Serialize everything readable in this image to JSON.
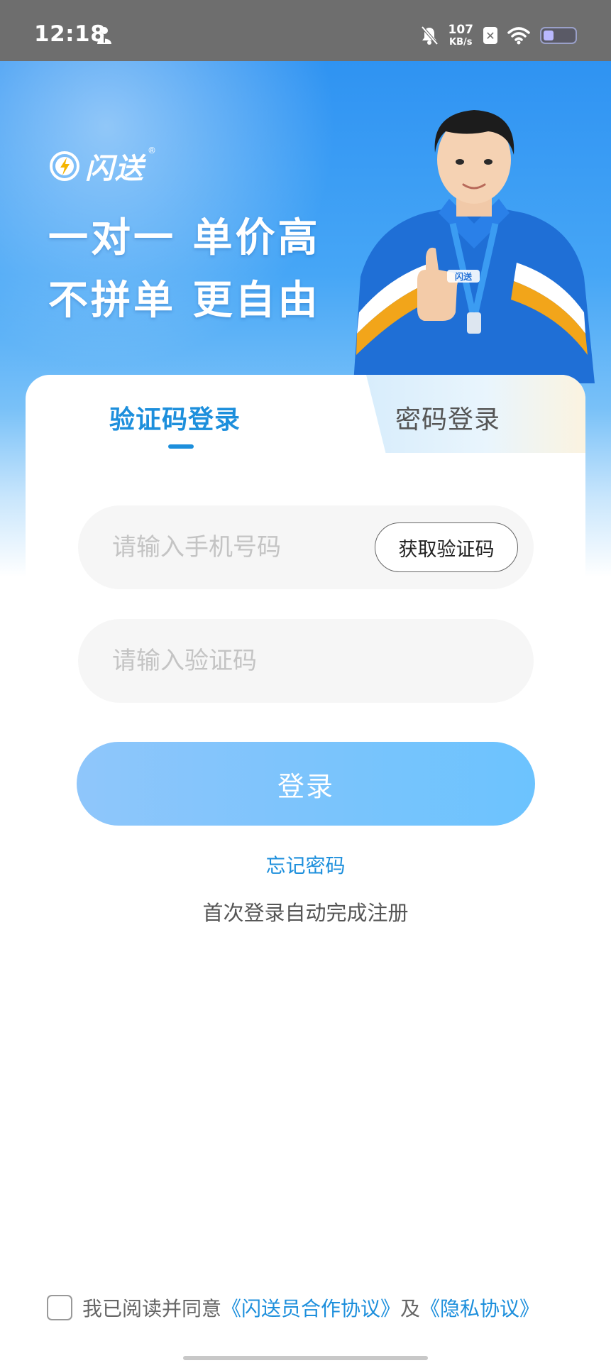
{
  "status_bar": {
    "time": "12:18",
    "net_speed_value": "107",
    "net_speed_unit": "KB/s",
    "icons": [
      "person-icon",
      "mute-bell-icon",
      "sim-x-icon",
      "wifi-icon",
      "battery-icon"
    ]
  },
  "brand": {
    "name": "闪送",
    "registered_mark": "®",
    "slogan_line1": "一对一 单价高",
    "slogan_line2": "不拼单 更自由",
    "badge_text": "闪送"
  },
  "login": {
    "tabs": [
      {
        "label": "验证码登录",
        "active": true
      },
      {
        "label": "密码登录",
        "active": false
      }
    ],
    "phone_placeholder": "请输入手机号码",
    "get_code_label": "获取验证码",
    "code_placeholder": "请输入验证码",
    "submit_label": "登录",
    "forgot_label": "忘记密码",
    "auto_register_note": "首次登录自动完成注册"
  },
  "agreement": {
    "checked": false,
    "prefix": "我已阅读并同意",
    "link1": "《闪送员合作协议》",
    "conjunction": "及",
    "link2": "《隐私协议》"
  },
  "colors": {
    "accent": "#1d8fdc",
    "hero_blue": "#2f93f2",
    "button_gradient_start": "#8fc6fb",
    "button_gradient_end": "#6cc3fe",
    "status_bar_bg": "#6e6e6e"
  }
}
